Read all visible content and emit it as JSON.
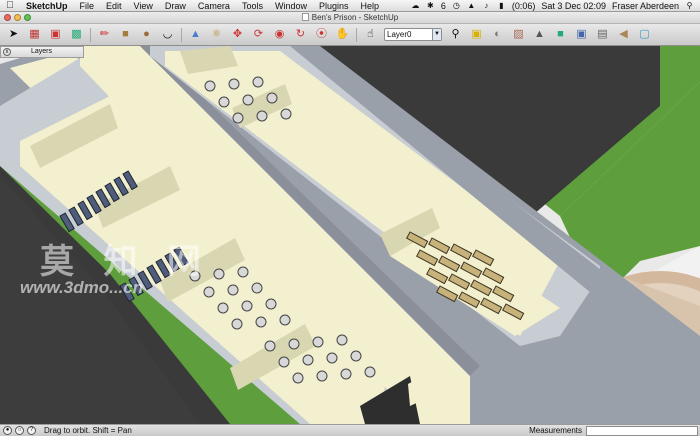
{
  "menubar": {
    "apple_icon": "apple-icon",
    "menus": [
      "SketchUp",
      "File",
      "Edit",
      "View",
      "Draw",
      "Camera",
      "Tools",
      "Window",
      "Plugins",
      "Help"
    ],
    "battery": "(0:06)",
    "bluetooth_count": "6",
    "datetime": "Sat 3 Dec  02:09",
    "user": "Fraser Aberdeen"
  },
  "window": {
    "title": "Ben's Prison - SketchUp"
  },
  "toolbar": {
    "tools": [
      "select-arrow-icon",
      "make-component-icon",
      "paint-bucket-icon",
      "eraser-icon",
      "pencil-icon",
      "rectangle-icon",
      "circle-icon",
      "arc-icon",
      "push-pull-icon",
      "offset-icon",
      "move-icon",
      "rotate-icon",
      "scale-icon",
      "follow-me-icon",
      "orbit-icon",
      "pan-icon"
    ],
    "layer_value": "Layer0",
    "right_tools": [
      "zoom-icon",
      "paint-icon",
      "shadow-icon",
      "components-icon",
      "materials-icon",
      "styles-icon",
      "scenes-icon",
      "get-models-icon",
      "share-model-icon"
    ]
  },
  "layers_palette": {
    "title": "Layers"
  },
  "statusbar": {
    "hint": "Drag to orbit.  Shift = Pan",
    "measurements_label": "Measurements",
    "measurements_value": ""
  },
  "viewport": {
    "watermark_cjk": "莫 知 网",
    "watermark_url": "www.3dmo...cn",
    "colors": {
      "grass": "#5e9e3c",
      "asphalt": "#3a3a3a",
      "floor_cream": "#f3f0cf",
      "wall_top": "#c8ccd3",
      "wall_side": "#8a8f99",
      "interior_wall": "#d9d6b2",
      "gravel": "#d3b89e"
    }
  }
}
